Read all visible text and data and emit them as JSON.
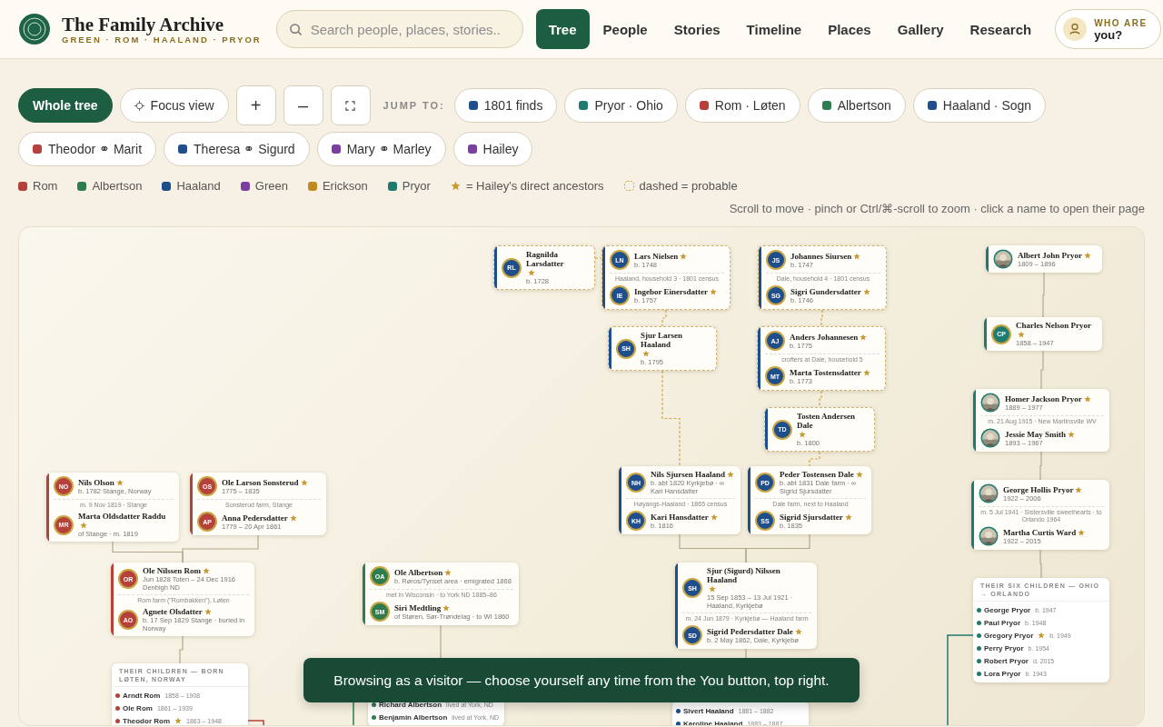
{
  "header": {
    "title": "The Family Archive",
    "subtitle": "GREEN · ROM · HAALAND · PRYOR",
    "search": {
      "placeholder": "Search people, places, stories.."
    },
    "tabs": [
      {
        "label": "Tree",
        "selected": true
      },
      {
        "label": "People",
        "selected": false
      },
      {
        "label": "Stories",
        "selected": false
      },
      {
        "label": "Timeline",
        "selected": false
      },
      {
        "label": "Places",
        "selected": false
      },
      {
        "label": "Gallery",
        "selected": false
      },
      {
        "label": "Research",
        "selected": false
      }
    ],
    "user_button": {
      "line_1": "WHO ARE",
      "line_2": "you?"
    }
  },
  "toolbar": {
    "views": [
      {
        "label": "Whole tree",
        "kind": "text",
        "selected": true
      },
      {
        "label": "Focus view",
        "kind": "focus",
        "selected": false
      }
    ],
    "zoom_in": "+",
    "zoom_out": "–",
    "jump_label": "JUMP TO:",
    "jumps": [
      {
        "label": "1801 finds",
        "color": "#1f4e8c"
      },
      {
        "label": "Pryor · Ohio",
        "color": "#1f7a70"
      },
      {
        "label": "Rom · Løten",
        "color": "#b5413a"
      },
      {
        "label": "Albertson",
        "color": "#2e7d4f"
      },
      {
        "label": "Haaland · Sogn",
        "color": "#1f4e8c"
      },
      {
        "label": "Theodor ⚭ Marit",
        "color": "#b5413a"
      },
      {
        "label": "Theresa ⚭ Sigurd",
        "color": "#1f4e8c"
      },
      {
        "label": "Mary ⚭ Marley",
        "color": "#7b3fa0"
      },
      {
        "label": "Hailey",
        "color": "#7b3fa0"
      }
    ]
  },
  "legend": {
    "families": [
      {
        "label": "Rom",
        "color": "#b5413a"
      },
      {
        "label": "Albertson",
        "color": "#2e7d4f"
      },
      {
        "label": "Haaland",
        "color": "#1f4e8c"
      },
      {
        "label": "Green",
        "color": "#7b3fa0"
      },
      {
        "label": "Erickson",
        "color": "#c08a1e"
      },
      {
        "label": "Pryor",
        "color": "#1f7a70"
      }
    ],
    "direct_label": "= Hailey's direct ancestors",
    "probable_label": "dashed = probable"
  },
  "hint": "Scroll to move · pinch or Ctrl/⌘-scroll to zoom · click a name to open their page",
  "tree": {
    "cards": [
      {
        "kind": "family",
        "color": "#1f4e8c",
        "probable": true,
        "people": [
          {
            "name": "Ragnilda Larsdatter",
            "star": true,
            "initials": "RL",
            "dates": "b. 1728"
          }
        ]
      },
      {
        "kind": "family",
        "color": "#1f4e8c",
        "probable": true,
        "note": "Haaland, household 3 · 1801 census",
        "people": [
          {
            "name": "Lars Nielsen",
            "star": true,
            "initials": "LN",
            "dates": "b. 1748"
          },
          {
            "name": "Ingebor Einersdatter",
            "star": true,
            "initials": "IE",
            "dates": "b. 1757"
          }
        ]
      },
      {
        "kind": "family",
        "color": "#1f4e8c",
        "probable": true,
        "note": "Dale, household 4 · 1801 census",
        "people": [
          {
            "name": "Johannes Siursen",
            "star": true,
            "initials": "JS",
            "dates": "b. 1747"
          },
          {
            "name": "Sigri Gundersdatter",
            "star": true,
            "initials": "SG",
            "dates": "b. 1746"
          }
        ]
      },
      {
        "kind": "family",
        "color": "#1f4e8c",
        "probable": true,
        "people": [
          {
            "name": "Sjur Larsen Haaland",
            "star": true,
            "initials": "SH",
            "dates": "b. 1795"
          }
        ]
      },
      {
        "kind": "family",
        "color": "#1f4e8c",
        "probable": true,
        "note": "crofters at Dale, household 5",
        "people": [
          {
            "name": "Anders Johannesen",
            "star": true,
            "initials": "AJ",
            "dates": "b. 1775"
          },
          {
            "name": "Marta Tostensdatter",
            "star": true,
            "initials": "MT",
            "dates": "b. 1773"
          }
        ]
      },
      {
        "kind": "family",
        "color": "#1f4e8c",
        "probable": true,
        "people": [
          {
            "name": "Tosten Andersen Dale",
            "star": true,
            "initials": "TD",
            "dates": "b. 1800"
          }
        ]
      },
      {
        "kind": "family",
        "color": "#1f4e8c",
        "probable": false,
        "note": "Høyangs-Haaland · 1865 census",
        "people": [
          {
            "name": "Nils Sjursen Haaland",
            "star": true,
            "initials": "NH",
            "dates": "b. abt 1820 Kyrkjebø · ∞ Kari Hansdatter"
          },
          {
            "name": "Kari Hansdatter",
            "star": true,
            "initials": "KH",
            "dates": "b. 1816"
          }
        ]
      },
      {
        "kind": "family",
        "color": "#1f4e8c",
        "probable": false,
        "note": "Dale farm, next to Haaland",
        "people": [
          {
            "name": "Peder Tostensen Dale",
            "star": true,
            "initials": "PD",
            "dates": "b. abt 1831 Dale farm · ∞ Sigrid Sjursdatter"
          },
          {
            "name": "Sigrid Sjursdatter",
            "star": true,
            "initials": "SS",
            "dates": "b. 1835"
          }
        ]
      },
      {
        "kind": "family",
        "color": "#1f4e8c",
        "probable": false,
        "note": "m. 24 Jun 1879 · Kyrkjebø — Haaland farm",
        "people": [
          {
            "name": "Sjur (Sigurd) Nilssen Haaland",
            "star": true,
            "initials": "SH",
            "dates": "15 Sep 1853 – 13 Jul 1921 · Haaland, Kyrkjebø"
          },
          {
            "name": "Sigrid Pedersdatter Dale",
            "star": true,
            "initials": "SD",
            "dates": "b. 2 May 1862, Dale, Kyrkjebø"
          }
        ]
      },
      {
        "kind": "children",
        "color": "#1f4e8c",
        "children": [
          {
            "name": "Sivert Haaland",
            "star": false,
            "dates": "1881 – 1882"
          },
          {
            "name": "Karoline Haaland",
            "star": false,
            "dates": "1883 – 1887"
          }
        ]
      },
      {
        "kind": "family",
        "color": "#1f7a70",
        "probable": false,
        "people": [
          {
            "name": "Albert John Pryor",
            "star": true,
            "photo": true,
            "dates": "1809 – 1896"
          }
        ]
      },
      {
        "kind": "family",
        "color": "#1f7a70",
        "probable": false,
        "people": [
          {
            "name": "Charles Nelson Pryor",
            "star": true,
            "initials": "CP",
            "dates": "1858 – 1947"
          }
        ]
      },
      {
        "kind": "family",
        "color": "#1f7a70",
        "probable": false,
        "note": "m. 21 Aug 1915 · New Martinsville WV",
        "people": [
          {
            "name": "Homer Jackson Pryor",
            "star": true,
            "photo": true,
            "dates": "1889 – 1977"
          },
          {
            "name": "Jessie May Smith",
            "star": true,
            "photo": true,
            "dates": "1893 – 1967"
          }
        ]
      },
      {
        "kind": "family",
        "color": "#1f7a70",
        "probable": false,
        "note": "m. 5 Jul 1941 · Sistersville sweethearts · to Orlando 1964",
        "people": [
          {
            "name": "George Hollis Pryor",
            "star": true,
            "photo": true,
            "dates": "1922 – 2006"
          },
          {
            "name": "Martha Curtis Ward",
            "star": true,
            "photo": true,
            "dates": "1922 – 2015"
          }
        ]
      },
      {
        "kind": "children",
        "color": "#1f7a70",
        "title": "THEIR SIX CHILDREN — OHIO → ORLANDO",
        "children": [
          {
            "name": "George Pryor",
            "star": false,
            "dates": "b. 1947"
          },
          {
            "name": "Paul Pryor",
            "star": false,
            "dates": "b. 1948"
          },
          {
            "name": "Gregory Pryor",
            "star": true,
            "dates": "b. 1949"
          },
          {
            "name": "Perry Pryor",
            "star": false,
            "dates": "b. 1954"
          },
          {
            "name": "Robert Pryor",
            "star": false,
            "dates": "d. 2015"
          },
          {
            "name": "Lora Pryor",
            "star": false,
            "dates": "b. 1943"
          }
        ]
      },
      {
        "kind": "family",
        "color": "#b5413a",
        "probable": false,
        "note": "m. 9 Nov 1819 · Stange",
        "people": [
          {
            "name": "Nils Olson",
            "star": true,
            "initials": "NO",
            "dates": "b. 1782 Stange, Norway"
          },
          {
            "name": "Marta Oldsdatter Raddu",
            "star": true,
            "initials": "MR",
            "dates": "of Stange · m. 1819"
          }
        ]
      },
      {
        "kind": "family",
        "color": "#b5413a",
        "probable": false,
        "note": "Sonsterud farm, Stange",
        "people": [
          {
            "name": "Ole Larson Sonsterud",
            "star": true,
            "initials": "OS",
            "dates": "1775 – 1835"
          },
          {
            "name": "Anna Pedersdatter",
            "star": true,
            "initials": "AP",
            "dates": "1779 – 20 Apr 1861"
          }
        ]
      },
      {
        "kind": "family",
        "color": "#b5413a",
        "probable": false,
        "note": "Rom farm (\"Rombakken\"), Løten",
        "people": [
          {
            "name": "Ole Nilssen Rom",
            "star": true,
            "initials": "OR",
            "dates": "Jun 1828 Toten – 24 Dec 1916 Denbigh ND"
          },
          {
            "name": "Agnete Olsdatter",
            "star": true,
            "initials": "AO",
            "dates": "b. 17 Sep 1829 Stange · buried in Norway"
          }
        ]
      },
      {
        "kind": "children",
        "color": "#b5413a",
        "title": "THEIR CHILDREN — BORN LØTEN, NORWAY",
        "children": [
          {
            "name": "Arndt Rom",
            "star": false,
            "dates": "1858 – 1908"
          },
          {
            "name": "Ole Rom",
            "star": false,
            "dates": "1861 – 1939"
          },
          {
            "name": "Theodor Rom",
            "star": true,
            "dates": "1863 – 1948"
          }
        ]
      },
      {
        "kind": "family",
        "color": "#2e7d4f",
        "probable": false,
        "note": "met in Wisconsin · to York ND 1885–86",
        "people": [
          {
            "name": "Ole Albertson",
            "star": true,
            "initials": "OA",
            "dates": "b. Røros/Tynset area · emigrated 1868"
          },
          {
            "name": "Siri Medtling",
            "star": true,
            "initials": "SM",
            "dates": "of Støren, Sør-Trøndelag · to WI 1860"
          }
        ]
      },
      {
        "kind": "children",
        "color": "#2e7d4f",
        "children": [
          {
            "name": "Richard Albertson",
            "star": false,
            "dates": "lived at York, ND"
          },
          {
            "name": "Benjamin Albertson",
            "star": false,
            "dates": "lived at York, ND"
          }
        ]
      }
    ]
  },
  "toast": "Browsing as a visitor — choose yourself any time from the You button, top right."
}
